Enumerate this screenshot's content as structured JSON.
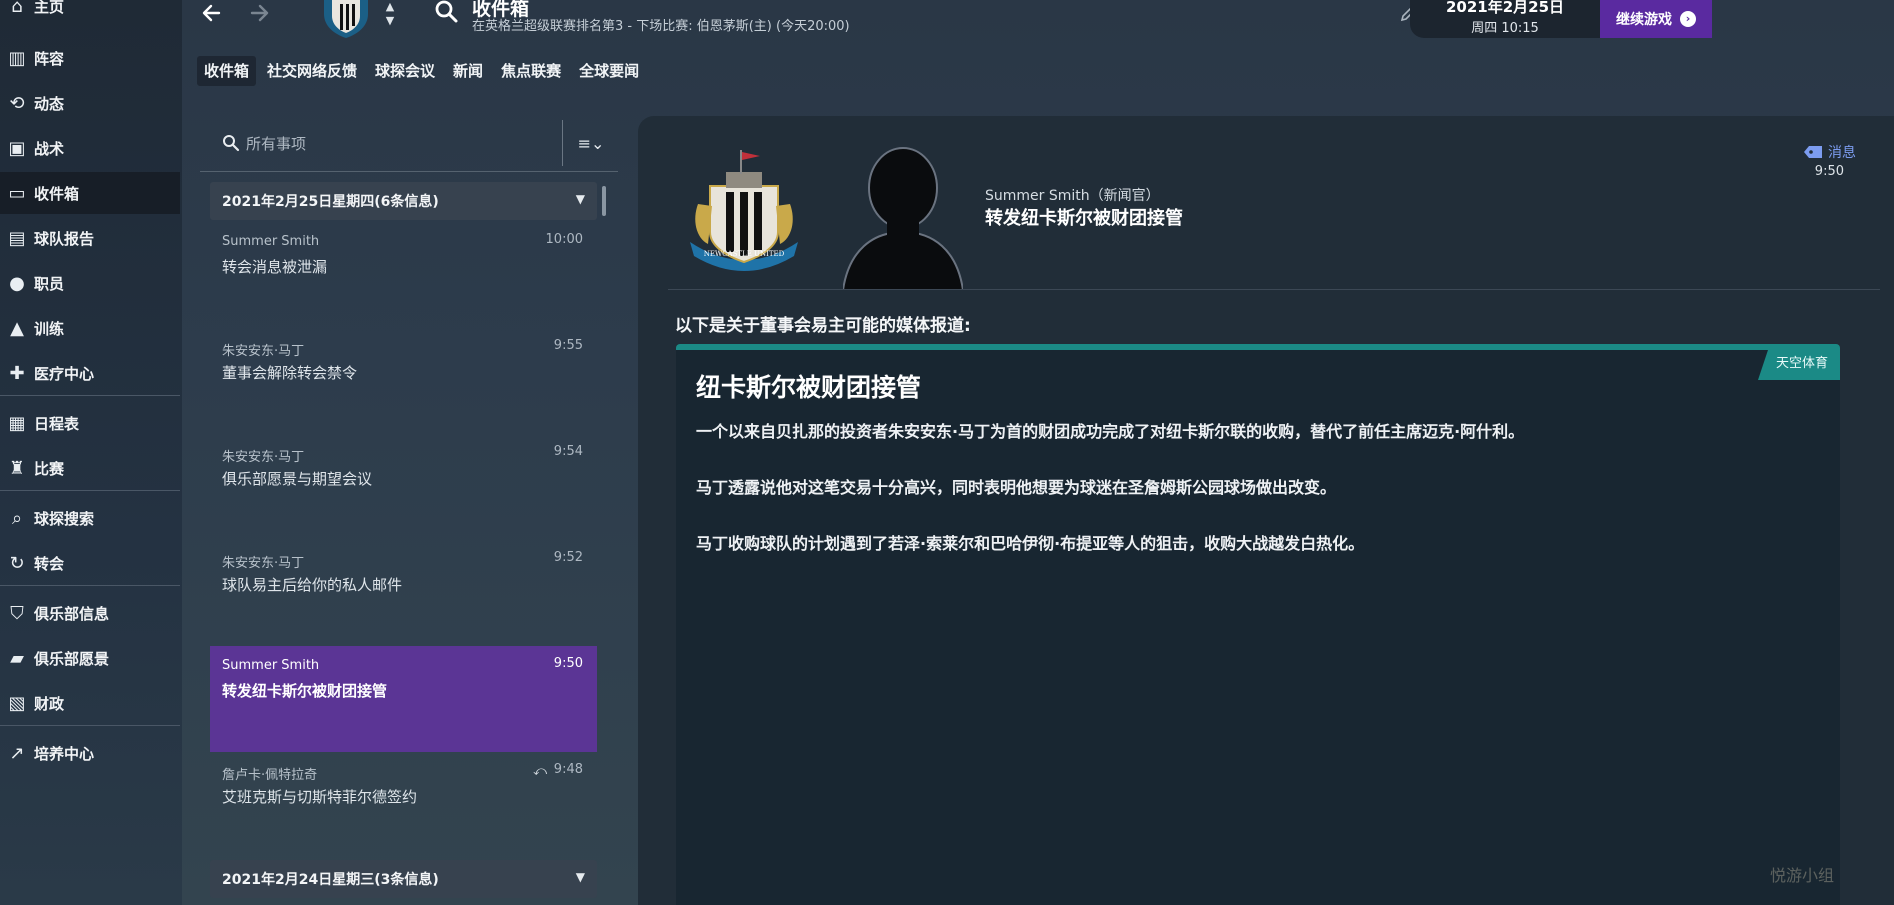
{
  "sidebar": {
    "items": [
      {
        "label": "主页",
        "icon": "home-icon"
      },
      {
        "label": "阵容",
        "icon": "squad-icon"
      },
      {
        "label": "动态",
        "icon": "dynamics-icon"
      },
      {
        "label": "战术",
        "icon": "tactics-icon"
      },
      {
        "label": "收件箱",
        "icon": "inbox-icon"
      },
      {
        "label": "球队报告",
        "icon": "report-icon"
      },
      {
        "label": "职员",
        "icon": "staff-icon"
      },
      {
        "label": "训练",
        "icon": "training-icon"
      },
      {
        "label": "医疗中心",
        "icon": "medical-icon"
      },
      {
        "label": "日程表",
        "icon": "calendar-icon"
      },
      {
        "label": "比赛",
        "icon": "trophy-icon"
      },
      {
        "label": "球探搜索",
        "icon": "scouting-icon"
      },
      {
        "label": "转会",
        "icon": "transfer-icon"
      },
      {
        "label": "俱乐部信息",
        "icon": "shield-icon"
      },
      {
        "label": "俱乐部愿景",
        "icon": "briefcase-icon"
      },
      {
        "label": "财政",
        "icon": "finance-icon"
      },
      {
        "label": "培养中心",
        "icon": "development-icon"
      }
    ],
    "active": "收件箱"
  },
  "topbar": {
    "title": "收件箱",
    "subtitle": "在英格兰超级联赛排名第3 - 下场比赛: 伯恩茅斯(主) (今天20:00)",
    "date": "2021年2月25日",
    "weekday_time": "周四 10:15",
    "continue_label": "继续游戏",
    "continue_icon": "arrow-right-icon"
  },
  "tabs": [
    "收件箱",
    "社交网络反馈",
    "球探会议",
    "新闻",
    "焦点联赛",
    "全球要闻"
  ],
  "inbox": {
    "search_placeholder": "所有事项",
    "day_groups": [
      {
        "label": "2021年2月25日星期四(6条信息)"
      },
      {
        "label": "2021年2月24日星期三(3条信息)"
      }
    ],
    "messages": [
      {
        "sender": "Summer Smith",
        "time": "10:00",
        "subject": "转会消息被泄漏"
      },
      {
        "sender": "朱安安东·马丁",
        "time": "9:55",
        "subject": "董事会解除转会禁令"
      },
      {
        "sender": "朱安安东·马丁",
        "time": "9:54",
        "subject": "俱乐部愿景与期望会议"
      },
      {
        "sender": "朱安安东·马丁",
        "time": "9:52",
        "subject": "球队易主后给你的私人邮件"
      },
      {
        "sender": "Summer Smith",
        "time": "9:50",
        "subject": "转发纽卡斯尔被财团接管"
      },
      {
        "sender": "詹卢卡·佩特拉奇",
        "time": "9:48",
        "subject": "艾班克斯与切斯特菲尔德签约"
      }
    ],
    "selected_index": 4
  },
  "detail": {
    "sender": "Summer Smith（新闻官）",
    "subject": "转发纽卡斯尔被财团接管",
    "tag": "消息",
    "time": "9:50",
    "crest_text": "NEWCASTLE UNITED",
    "intro": "以下是关于董事会易主可能的媒体报道:",
    "news": {
      "source": "天空体育",
      "headline": "纽卡斯尔被财团接管",
      "paragraphs": [
        "一个以来自贝扎那的投资者朱安安东·马丁为首的财团成功完成了对纽卡斯尔联的收购，替代了前任主席迈克·阿什利。",
        "马丁透露说他对这笔交易十分高兴，同时表明他想要为球迷在圣詹姆斯公园球场做出改变。",
        "马丁收购球队的计划遇到了若泽·索莱尔和巴哈伊彻·布提亚等人的狙击，收购大战越发白热化。"
      ]
    }
  },
  "watermark": "悦游小组",
  "colors": {
    "accent_purple": "#5a2aa0",
    "selected_row": "#5b3595",
    "news_teal": "#1b8a86",
    "tag_blue": "#7c9cf0"
  }
}
